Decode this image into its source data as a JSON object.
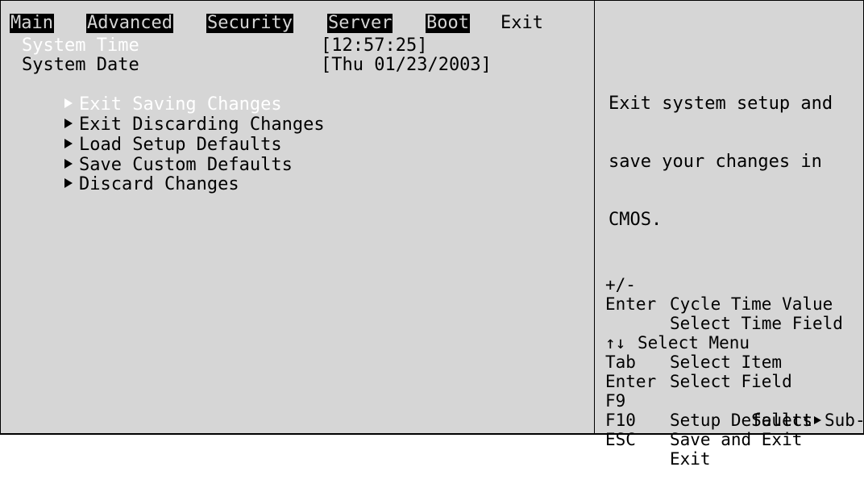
{
  "menu": {
    "tabs": [
      {
        "label": "Main"
      },
      {
        "label": "Advanced"
      },
      {
        "label": "Security"
      },
      {
        "label": "Server"
      },
      {
        "label": "Boot"
      },
      {
        "label": "Exit"
      }
    ],
    "active_tab": "Exit"
  },
  "main": {
    "system_time_label": "System Time",
    "system_time_value": "[12:57:25]",
    "system_date_label": "System Date",
    "system_date_value": "[Thu 01/23/2003]",
    "items": [
      {
        "label": "Exit Saving Changes"
      },
      {
        "label": "Exit Discarding Changes"
      },
      {
        "label": "Load Setup Defaults"
      },
      {
        "label": "Save Custom Defaults"
      },
      {
        "label": "Discard Changes"
      }
    ]
  },
  "help": {
    "lines": [
      "Exit system setup and",
      "save your changes in",
      "CMOS."
    ]
  },
  "keys": [
    {
      "key": "+/-",
      "desc": "Cycle Time Value"
    },
    {
      "key": "Enter",
      "desc": "Select Time Field"
    },
    {
      "key": "",
      "desc": "Select Menu"
    },
    {
      "key": "↑↓",
      "desc": "Select Item"
    },
    {
      "key": "Tab",
      "desc": "Select Field"
    },
    {
      "key": "Enter",
      "desc_pre": "Select",
      "desc_post": "Sub-Menu"
    },
    {
      "key": "F9",
      "desc": "Setup Defaults"
    },
    {
      "key": "F10",
      "desc": "Save and Exit"
    },
    {
      "key": "ESC",
      "desc": "Exit"
    }
  ],
  "colors": {
    "background": "#d6d6d6",
    "highlight_text": "#ffffff",
    "inverse_bg": "#000000"
  }
}
